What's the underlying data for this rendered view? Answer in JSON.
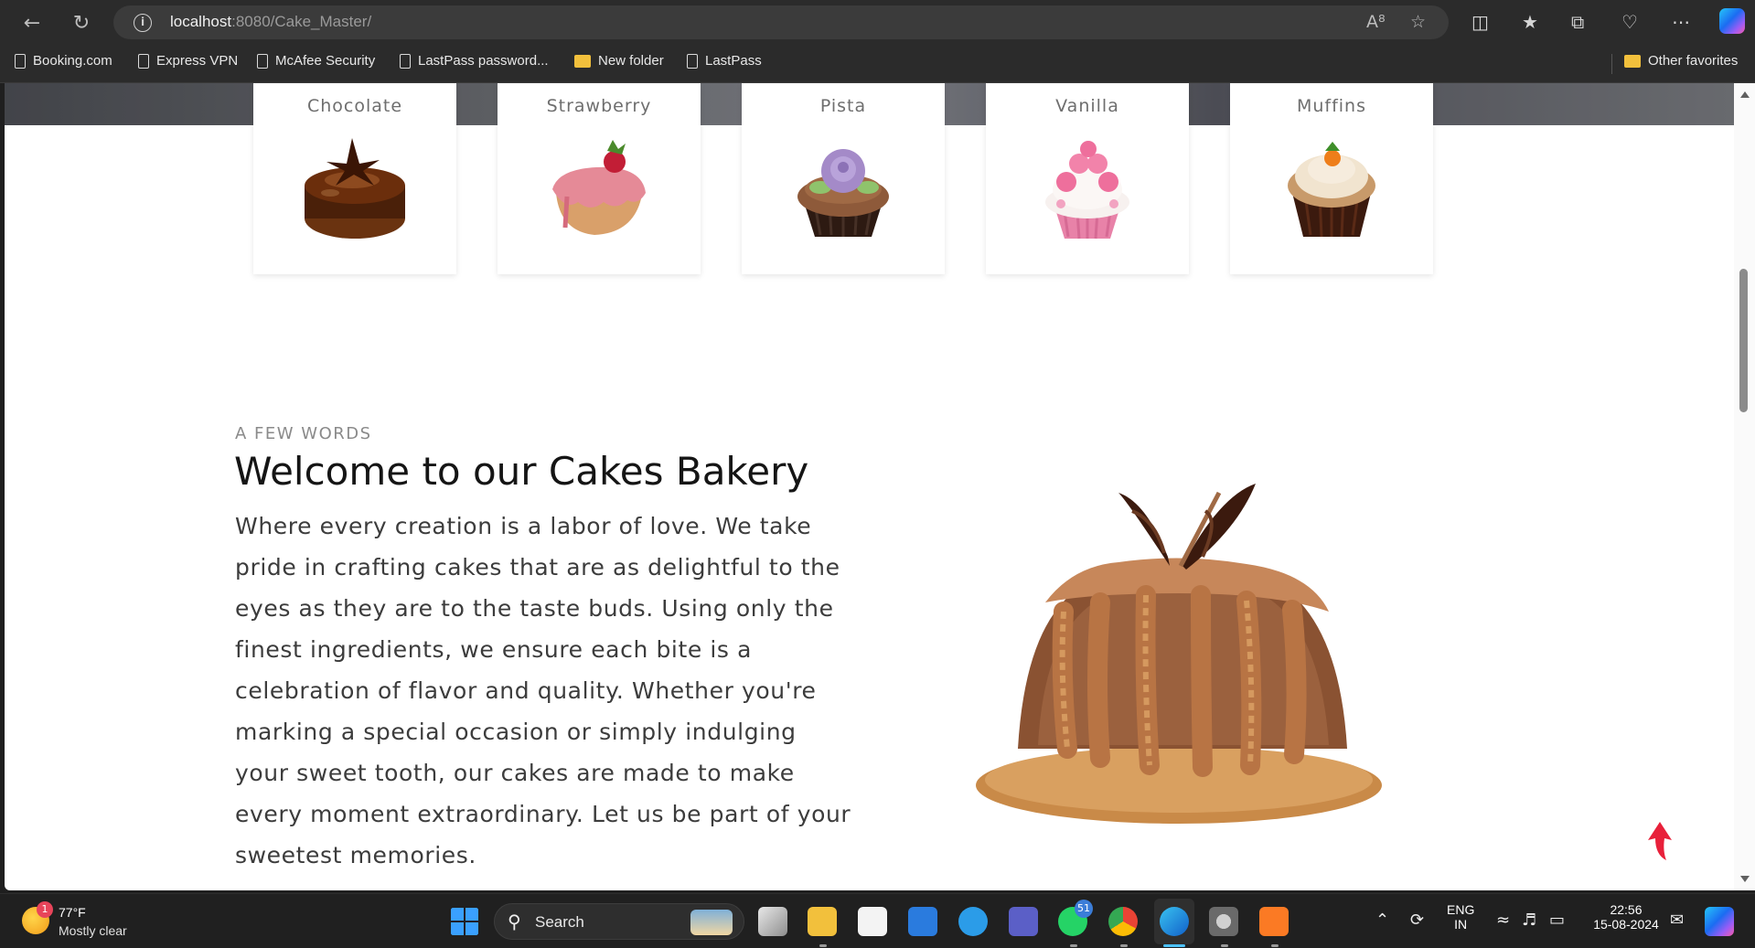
{
  "browser": {
    "url_host": "localhost",
    "url_path": ":8080/Cake_Master/",
    "bookmarks": [
      {
        "label": "Booking.com",
        "icon": "page-icon"
      },
      {
        "label": "Express VPN",
        "icon": "page-icon"
      },
      {
        "label": "McAfee Security",
        "icon": "page-icon"
      },
      {
        "label": "LastPass password...",
        "icon": "page-icon"
      },
      {
        "label": "New folder",
        "icon": "folder-icon"
      },
      {
        "label": "LastPass",
        "icon": "page-icon"
      }
    ],
    "other_favorites": "Other favorites"
  },
  "page": {
    "categories": [
      {
        "title": "Chocolate"
      },
      {
        "title": "Strawberry"
      },
      {
        "title": "Pista"
      },
      {
        "title": "Vanilla"
      },
      {
        "title": "Muffins"
      }
    ],
    "about": {
      "eyebrow": "A FEW WORDS",
      "heading": "Welcome to our Cakes Bakery",
      "body": "Where every creation is a labor of love. We take pride in crafting cakes that are as delightful to the eyes as they are to the taste buds. Using only the finest ingredients, we ensure each bite is a celebration of flavor and quality. Whether you're marking a special occasion or simply indulging your sweet tooth, our cakes are made to make every moment extraordinary. Let us be part of your sweetest memories."
    },
    "accent_color": "#e8203a"
  },
  "taskbar": {
    "weather_badge": "1",
    "temperature": "77°F",
    "condition": "Mostly clear",
    "search_label": "Search",
    "whatsapp_count": "51",
    "language": "ENG",
    "region": "IN",
    "time": "22:56",
    "date": "15-08-2024"
  }
}
